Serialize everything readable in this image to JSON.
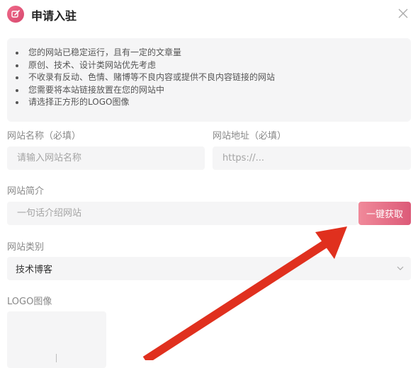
{
  "dialog": {
    "title": "申请入驻",
    "accent": "#d7486e",
    "icons": {
      "logo": "edit-icon",
      "close": "close-icon"
    }
  },
  "notice": {
    "items": [
      "您的网站已稳定运行，且有一定的文章量",
      "原创、技术、设计类网站优先考虑",
      "不收录有反动、色情、赌博等不良内容或提供不良内容链接的网站",
      "您需要将本站链接放置在您的网站中",
      "请选择正方形的LOGO图像"
    ]
  },
  "form": {
    "site_name": {
      "label": "网站名称（必填）",
      "placeholder": "请输入网站名称",
      "value": ""
    },
    "site_url": {
      "label": "网站地址（必填）",
      "placeholder": "https://...",
      "value": ""
    },
    "site_intro": {
      "label": "网站简介",
      "placeholder": "一句话介绍网站",
      "value": ""
    },
    "auto_fetch_button": "一键获取",
    "site_category": {
      "label": "网站类别",
      "selected": "技术博客"
    },
    "logo": {
      "label": "LOGO图像"
    }
  },
  "annotation": {
    "arrow_color": "#e0301e"
  }
}
